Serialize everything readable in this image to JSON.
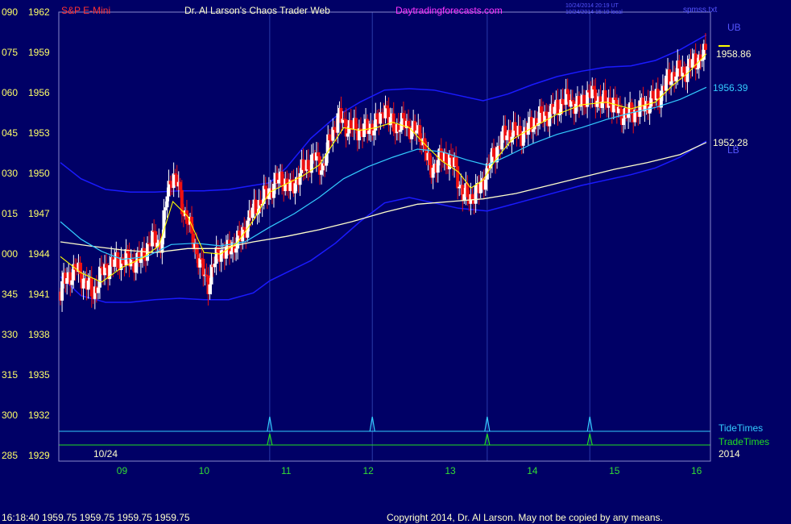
{
  "header": {
    "symbol": "S&P E-Mini",
    "site_title": "Dr. Al Larson's Chaos Trader Web",
    "site_url": "Daytradingforecasts.com",
    "stamp_ut": "10/24/2014 20:19 UT",
    "stamp_local": "10/24/2014 15:19 local",
    "file_name": "spmss.txt"
  },
  "footer": {
    "quote_line": "16:18:40  1959.75  1959.75  1959.75  1959.75",
    "copyright": "Copyright 2014, Dr. Al Larson. May not be copied by any means."
  },
  "colors": {
    "background": "#000066",
    "axis_labels": "#ffff66",
    "hour_labels": "#33dd33",
    "up_bar": "#ffffff",
    "down_bar": "#ee1111",
    "band": "#1a1aff",
    "cyan_avg": "#33ccff",
    "slow_avg": "#ffffcc",
    "fast_avg": "#ffff00",
    "tide": "#33ccff",
    "trade": "#22dd22",
    "title_red": "#ff3333",
    "site_magenta": "#ff33ff"
  },
  "chart_data": {
    "type": "candlestick",
    "title": "S&P E-Mini",
    "date_label": "10/24",
    "year_label": "2014",
    "y_ticks": [
      {
        "code": "090",
        "price": "1962"
      },
      {
        "code": "075",
        "price": "1959"
      },
      {
        "code": "060",
        "price": "1956"
      },
      {
        "code": "045",
        "price": "1953"
      },
      {
        "code": "030",
        "price": "1950"
      },
      {
        "code": "015",
        "price": "1947"
      },
      {
        "code": "000",
        "price": "1944"
      },
      {
        "code": "345",
        "price": "1941"
      },
      {
        "code": "330",
        "price": "1938"
      },
      {
        "code": "315",
        "price": "1935"
      },
      {
        "code": "300",
        "price": "1932"
      },
      {
        "code": "285",
        "price": "1929"
      }
    ],
    "y_values": [
      1962,
      1959,
      1956,
      1953,
      1950,
      1947,
      1944,
      1941,
      1938,
      1935,
      1932,
      1929
    ],
    "ylim": [
      1929,
      1962
    ],
    "x_ticks": [
      "09",
      "10",
      "11",
      "12",
      "13",
      "14",
      "15",
      "16"
    ],
    "x_tick_hours": [
      9,
      10,
      11,
      12,
      13,
      14,
      15,
      16
    ],
    "xlim": [
      8.23,
      16.17
    ],
    "vertical_lines_hours": [
      10.8,
      12.05,
      13.45,
      14.7
    ],
    "tide_spike_hours": [
      10.8,
      12.05,
      13.45,
      14.7
    ],
    "trade_spike_hours": [
      10.8,
      13.45,
      14.7
    ],
    "tide_label": "TideTimes",
    "trade_label": "TradeTimes",
    "band_labels": [
      "UB",
      "LB"
    ],
    "value_labels": [
      "1958.86",
      "1956.39",
      "1952.28"
    ],
    "price_anchors": [
      [
        8.25,
        1941.2
      ],
      [
        8.3,
        1942.0
      ],
      [
        8.38,
        1942.5
      ],
      [
        8.45,
        1942.8
      ],
      [
        8.55,
        1942.0
      ],
      [
        8.65,
        1941.0
      ],
      [
        8.75,
        1942.6
      ],
      [
        8.85,
        1943.2
      ],
      [
        9.0,
        1943.5
      ],
      [
        9.1,
        1943.6
      ],
      [
        9.2,
        1943.3
      ],
      [
        9.3,
        1944.4
      ],
      [
        9.4,
        1945.3
      ],
      [
        9.48,
        1944.6
      ],
      [
        9.55,
        1948.6
      ],
      [
        9.6,
        1949.8
      ],
      [
        9.68,
        1949.2
      ],
      [
        9.75,
        1947.2
      ],
      [
        9.85,
        1945.5
      ],
      [
        9.9,
        1944.4
      ],
      [
        9.95,
        1943.2
      ],
      [
        10.05,
        1941.8
      ],
      [
        10.1,
        1942.8
      ],
      [
        10.18,
        1944.3
      ],
      [
        10.27,
        1944.1
      ],
      [
        10.35,
        1944.6
      ],
      [
        10.45,
        1945.2
      ],
      [
        10.55,
        1946.8
      ],
      [
        10.65,
        1947.6
      ],
      [
        10.75,
        1948.4
      ],
      [
        10.85,
        1949.2
      ],
      [
        10.95,
        1949.6
      ],
      [
        11.05,
        1948.8
      ],
      [
        11.15,
        1949.8
      ],
      [
        11.25,
        1950.6
      ],
      [
        11.35,
        1951.2
      ],
      [
        11.45,
        1950.4
      ],
      [
        11.55,
        1953.0
      ],
      [
        11.65,
        1954.2
      ],
      [
        11.75,
        1953.4
      ],
      [
        11.85,
        1953.3
      ],
      [
        11.95,
        1953.2
      ],
      [
        12.05,
        1953.5
      ],
      [
        12.15,
        1954.0
      ],
      [
        12.2,
        1955.3
      ],
      [
        12.25,
        1953.9
      ],
      [
        12.35,
        1953.4
      ],
      [
        12.45,
        1953.8
      ],
      [
        12.55,
        1953.2
      ],
      [
        12.65,
        1952.8
      ],
      [
        12.75,
        1950.2
      ],
      [
        12.85,
        1950.9
      ],
      [
        12.95,
        1951.2
      ],
      [
        13.05,
        1950.6
      ],
      [
        13.15,
        1948.4
      ],
      [
        13.25,
        1948.2
      ],
      [
        13.35,
        1948.8
      ],
      [
        13.45,
        1950.2
      ],
      [
        13.55,
        1951.6
      ],
      [
        13.65,
        1952.8
      ],
      [
        13.75,
        1953.1
      ],
      [
        13.85,
        1952.9
      ],
      [
        13.95,
        1953.3
      ],
      [
        14.05,
        1954.0
      ],
      [
        14.15,
        1954.3
      ],
      [
        14.25,
        1954.6
      ],
      [
        14.35,
        1955.2
      ],
      [
        14.45,
        1955.6
      ],
      [
        14.55,
        1954.9
      ],
      [
        14.65,
        1955.7
      ],
      [
        14.75,
        1955.9
      ],
      [
        14.85,
        1955.2
      ],
      [
        14.95,
        1955.4
      ],
      [
        15.05,
        1954.6
      ],
      [
        15.15,
        1954.3
      ],
      [
        15.25,
        1954.6
      ],
      [
        15.35,
        1955.0
      ],
      [
        15.45,
        1955.4
      ],
      [
        15.55,
        1955.8
      ],
      [
        15.65,
        1957.0
      ],
      [
        15.75,
        1957.5
      ],
      [
        15.85,
        1957.6
      ],
      [
        15.95,
        1958.2
      ],
      [
        16.05,
        1958.6
      ],
      [
        16.12,
        1958.9
      ]
    ],
    "fast_avg": [
      [
        8.25,
        1943.8
      ],
      [
        8.5,
        1942.6
      ],
      [
        8.75,
        1941.9
      ],
      [
        9.0,
        1943.0
      ],
      [
        9.25,
        1943.7
      ],
      [
        9.45,
        1944.6
      ],
      [
        9.62,
        1947.9
      ],
      [
        9.8,
        1946.8
      ],
      [
        10.0,
        1944.1
      ],
      [
        10.2,
        1944.0
      ],
      [
        10.4,
        1944.8
      ],
      [
        10.6,
        1946.5
      ],
      [
        10.8,
        1948.6
      ],
      [
        11.0,
        1949.2
      ],
      [
        11.2,
        1949.8
      ],
      [
        11.4,
        1950.6
      ],
      [
        11.55,
        1952.0
      ],
      [
        11.7,
        1953.4
      ],
      [
        11.9,
        1953.2
      ],
      [
        12.1,
        1953.4
      ],
      [
        12.3,
        1953.8
      ],
      [
        12.5,
        1953.4
      ],
      [
        12.7,
        1952.1
      ],
      [
        12.9,
        1950.9
      ],
      [
        13.1,
        1950.1
      ],
      [
        13.25,
        1948.9
      ],
      [
        13.4,
        1949.5
      ],
      [
        13.55,
        1951.0
      ],
      [
        13.75,
        1952.5
      ],
      [
        14.0,
        1953.4
      ],
      [
        14.3,
        1954.4
      ],
      [
        14.6,
        1955.1
      ],
      [
        14.9,
        1955.3
      ],
      [
        15.2,
        1954.8
      ],
      [
        15.5,
        1955.3
      ],
      [
        15.7,
        1956.5
      ],
      [
        15.9,
        1957.5
      ],
      [
        16.12,
        1958.9
      ]
    ],
    "cyan_avg": [
      [
        8.25,
        1946.4
      ],
      [
        8.5,
        1945.1
      ],
      [
        8.75,
        1944.2
      ],
      [
        9.0,
        1943.6
      ],
      [
        9.3,
        1943.8
      ],
      [
        9.6,
        1944.7
      ],
      [
        9.9,
        1944.8
      ],
      [
        10.2,
        1944.6
      ],
      [
        10.5,
        1944.9
      ],
      [
        10.8,
        1946.0
      ],
      [
        11.1,
        1947.0
      ],
      [
        11.4,
        1948.2
      ],
      [
        11.7,
        1949.6
      ],
      [
        12.0,
        1950.5
      ],
      [
        12.3,
        1951.2
      ],
      [
        12.6,
        1951.8
      ],
      [
        12.9,
        1951.6
      ],
      [
        13.2,
        1951.0
      ],
      [
        13.45,
        1950.6
      ],
      [
        13.7,
        1951.3
      ],
      [
        14.0,
        1952.2
      ],
      [
        14.3,
        1952.9
      ],
      [
        14.6,
        1953.4
      ],
      [
        14.9,
        1954.0
      ],
      [
        15.2,
        1954.5
      ],
      [
        15.5,
        1954.9
      ],
      [
        15.8,
        1955.5
      ],
      [
        16.12,
        1956.4
      ]
    ],
    "slow_avg": [
      [
        8.25,
        1944.9
      ],
      [
        8.6,
        1944.6
      ],
      [
        9.0,
        1944.3
      ],
      [
        9.4,
        1944.1
      ],
      [
        9.8,
        1944.4
      ],
      [
        10.2,
        1944.4
      ],
      [
        10.6,
        1944.9
      ],
      [
        11.0,
        1945.3
      ],
      [
        11.4,
        1945.8
      ],
      [
        11.8,
        1946.4
      ],
      [
        12.2,
        1947.1
      ],
      [
        12.6,
        1947.7
      ],
      [
        13.0,
        1947.9
      ],
      [
        13.4,
        1948.1
      ],
      [
        13.8,
        1948.5
      ],
      [
        14.2,
        1949.1
      ],
      [
        14.6,
        1949.7
      ],
      [
        15.0,
        1950.3
      ],
      [
        15.4,
        1950.8
      ],
      [
        15.8,
        1951.4
      ],
      [
        16.12,
        1952.3
      ]
    ],
    "upper_band": [
      [
        8.25,
        1950.8
      ],
      [
        8.5,
        1949.6
      ],
      [
        8.8,
        1948.8
      ],
      [
        9.1,
        1948.6
      ],
      [
        9.4,
        1948.6
      ],
      [
        9.7,
        1948.7
      ],
      [
        10.0,
        1948.7
      ],
      [
        10.3,
        1948.8
      ],
      [
        10.6,
        1949.1
      ],
      [
        10.8,
        1949.3
      ],
      [
        11.0,
        1950.4
      ],
      [
        11.3,
        1952.6
      ],
      [
        11.6,
        1954.2
      ],
      [
        11.9,
        1955.3
      ],
      [
        12.2,
        1956.2
      ],
      [
        12.5,
        1956.3
      ],
      [
        12.8,
        1956.2
      ],
      [
        13.1,
        1955.8
      ],
      [
        13.4,
        1955.4
      ],
      [
        13.7,
        1955.9
      ],
      [
        14.0,
        1956.6
      ],
      [
        14.3,
        1957.2
      ],
      [
        14.6,
        1957.6
      ],
      [
        14.9,
        1957.9
      ],
      [
        15.2,
        1958.0
      ],
      [
        15.5,
        1958.4
      ],
      [
        15.8,
        1959.2
      ],
      [
        16.12,
        1960.3
      ]
    ],
    "lower_band": [
      [
        8.25,
        1942.3
      ],
      [
        8.5,
        1940.9
      ],
      [
        8.8,
        1940.4
      ],
      [
        9.1,
        1940.4
      ],
      [
        9.4,
        1940.6
      ],
      [
        9.7,
        1940.7
      ],
      [
        10.0,
        1940.6
      ],
      [
        10.3,
        1940.6
      ],
      [
        10.6,
        1941.1
      ],
      [
        10.8,
        1942.0
      ],
      [
        11.0,
        1942.6
      ],
      [
        11.3,
        1943.5
      ],
      [
        11.6,
        1944.8
      ],
      [
        11.9,
        1946.4
      ],
      [
        12.2,
        1947.8
      ],
      [
        12.5,
        1948.2
      ],
      [
        12.8,
        1947.8
      ],
      [
        13.1,
        1947.4
      ],
      [
        13.45,
        1947.2
      ],
      [
        13.7,
        1947.6
      ],
      [
        14.0,
        1948.1
      ],
      [
        14.3,
        1948.6
      ],
      [
        14.6,
        1949.1
      ],
      [
        14.9,
        1949.5
      ],
      [
        15.2,
        1949.9
      ],
      [
        15.5,
        1950.4
      ],
      [
        15.8,
        1951.2
      ],
      [
        16.12,
        1952.4
      ]
    ]
  }
}
